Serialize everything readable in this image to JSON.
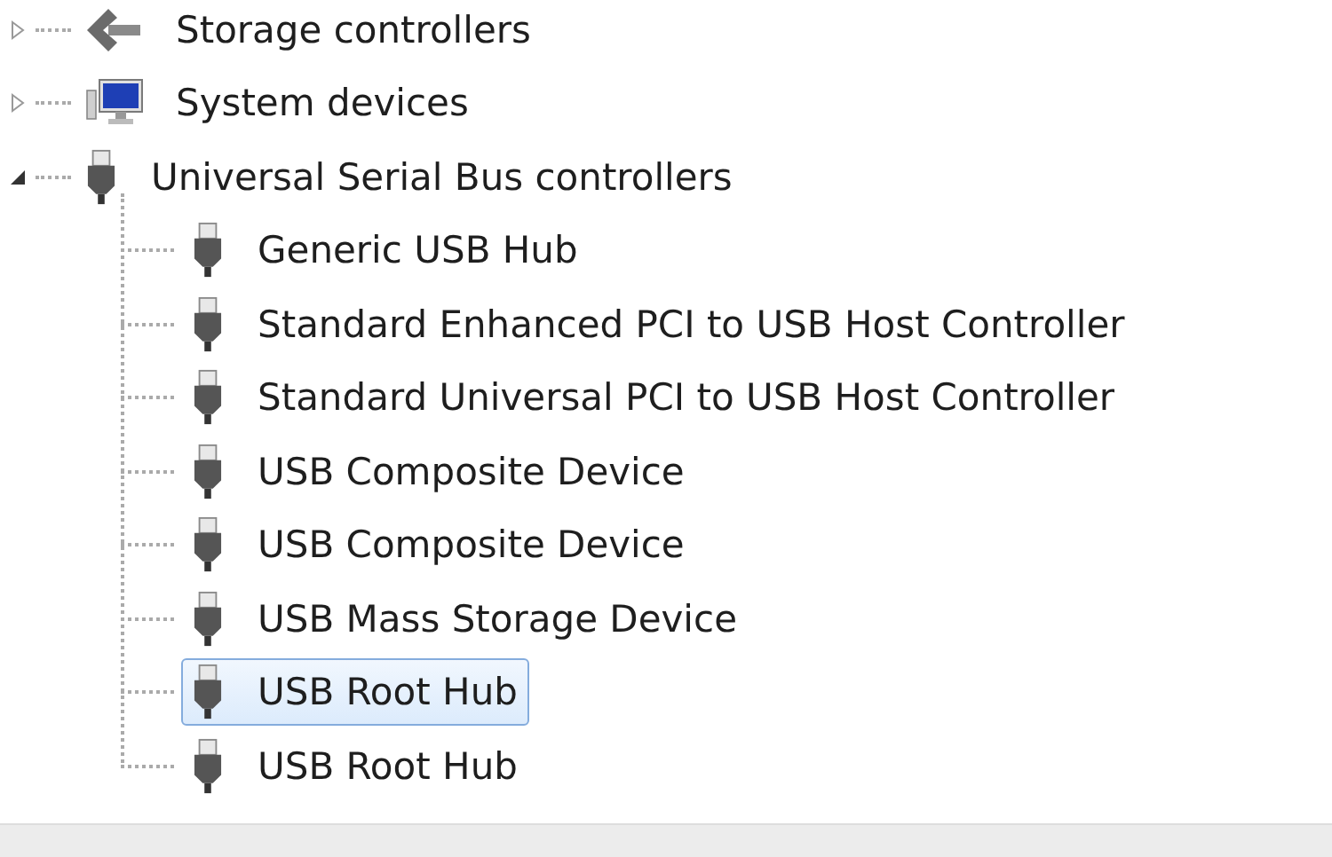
{
  "tree": [
    {
      "label": "Storage controllers",
      "kind": "storage",
      "expanded": false,
      "selected": false
    },
    {
      "label": "System devices",
      "kind": "system",
      "expanded": false,
      "selected": false
    },
    {
      "label": "Universal Serial Bus controllers",
      "kind": "usb",
      "expanded": true,
      "selected": false,
      "children": [
        {
          "label": "Generic USB Hub",
          "kind": "usb",
          "selected": false
        },
        {
          "label": "Standard Enhanced PCI to USB Host Controller",
          "kind": "usb",
          "selected": false
        },
        {
          "label": "Standard Universal PCI to USB Host Controller",
          "kind": "usb",
          "selected": false
        },
        {
          "label": "USB Composite Device",
          "kind": "usb",
          "selected": false
        },
        {
          "label": "USB Composite Device",
          "kind": "usb",
          "selected": false
        },
        {
          "label": "USB Mass Storage Device",
          "kind": "usb",
          "selected": false
        },
        {
          "label": "USB Root Hub",
          "kind": "usb",
          "selected": true
        },
        {
          "label": "USB Root Hub",
          "kind": "usb",
          "selected": false
        }
      ]
    }
  ]
}
